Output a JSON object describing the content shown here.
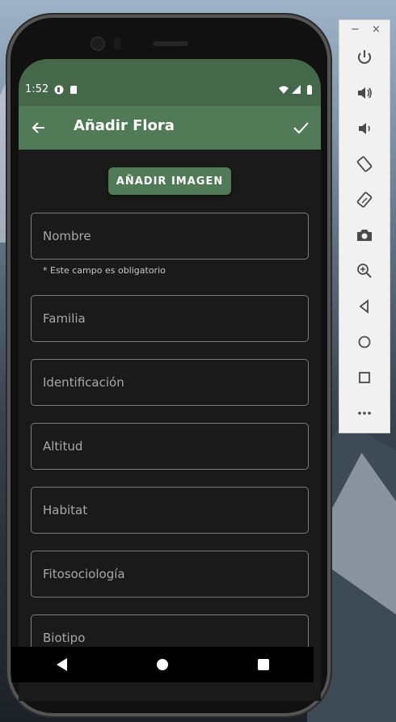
{
  "statusbar": {
    "time": "1:52"
  },
  "appbar": {
    "title": "Añadir Flora"
  },
  "form": {
    "add_image_label": "AÑADIR IMAGEN",
    "fields": [
      {
        "placeholder": "Nombre",
        "value": ""
      },
      {
        "placeholder": "Familia",
        "value": ""
      },
      {
        "placeholder": "Identificación",
        "value": ""
      },
      {
        "placeholder": "Altitud",
        "value": ""
      },
      {
        "placeholder": "Habitat",
        "value": ""
      },
      {
        "placeholder": "Fitosociología",
        "value": ""
      },
      {
        "placeholder": "Biotipo",
        "value": ""
      }
    ],
    "required_helper": "* Este campo es obligatorio"
  },
  "emulator_toolbar": {
    "minimize": "−",
    "close": "×",
    "buttons": [
      "power-icon",
      "volume-up-icon",
      "volume-down-icon",
      "rotate-left-icon",
      "rotate-right-icon",
      "camera-icon",
      "zoom-icon",
      "back-icon",
      "home-icon",
      "overview-icon",
      "more-icon"
    ]
  },
  "colors": {
    "statusbar": "#46684a",
    "appbar": "#517b56",
    "background": "#1a1a1a"
  }
}
